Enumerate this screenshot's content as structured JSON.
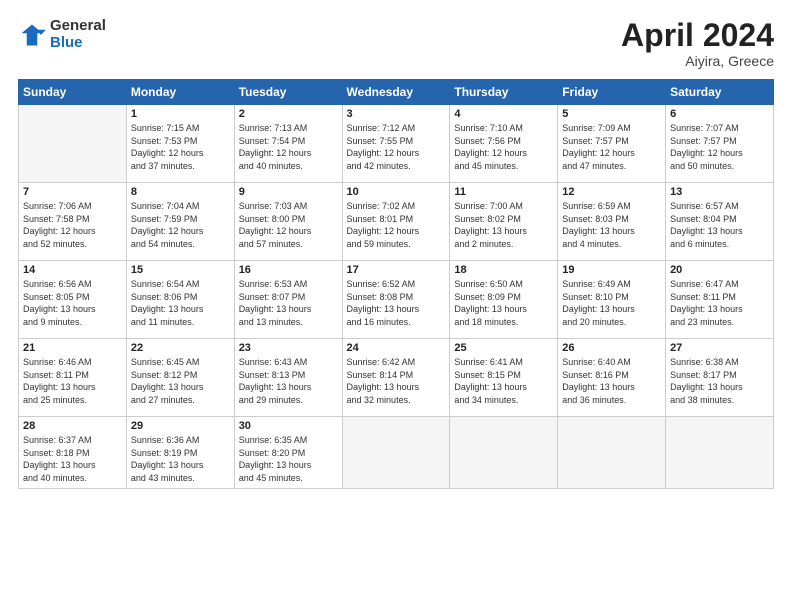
{
  "header": {
    "logo_general": "General",
    "logo_blue": "Blue",
    "month_title": "April 2024",
    "location": "Aiyira, Greece"
  },
  "days_of_week": [
    "Sunday",
    "Monday",
    "Tuesday",
    "Wednesday",
    "Thursday",
    "Friday",
    "Saturday"
  ],
  "weeks": [
    [
      {
        "num": "",
        "info": ""
      },
      {
        "num": "1",
        "info": "Sunrise: 7:15 AM\nSunset: 7:53 PM\nDaylight: 12 hours\nand 37 minutes."
      },
      {
        "num": "2",
        "info": "Sunrise: 7:13 AM\nSunset: 7:54 PM\nDaylight: 12 hours\nand 40 minutes."
      },
      {
        "num": "3",
        "info": "Sunrise: 7:12 AM\nSunset: 7:55 PM\nDaylight: 12 hours\nand 42 minutes."
      },
      {
        "num": "4",
        "info": "Sunrise: 7:10 AM\nSunset: 7:56 PM\nDaylight: 12 hours\nand 45 minutes."
      },
      {
        "num": "5",
        "info": "Sunrise: 7:09 AM\nSunset: 7:57 PM\nDaylight: 12 hours\nand 47 minutes."
      },
      {
        "num": "6",
        "info": "Sunrise: 7:07 AM\nSunset: 7:57 PM\nDaylight: 12 hours\nand 50 minutes."
      }
    ],
    [
      {
        "num": "7",
        "info": "Sunrise: 7:06 AM\nSunset: 7:58 PM\nDaylight: 12 hours\nand 52 minutes."
      },
      {
        "num": "8",
        "info": "Sunrise: 7:04 AM\nSunset: 7:59 PM\nDaylight: 12 hours\nand 54 minutes."
      },
      {
        "num": "9",
        "info": "Sunrise: 7:03 AM\nSunset: 8:00 PM\nDaylight: 12 hours\nand 57 minutes."
      },
      {
        "num": "10",
        "info": "Sunrise: 7:02 AM\nSunset: 8:01 PM\nDaylight: 12 hours\nand 59 minutes."
      },
      {
        "num": "11",
        "info": "Sunrise: 7:00 AM\nSunset: 8:02 PM\nDaylight: 13 hours\nand 2 minutes."
      },
      {
        "num": "12",
        "info": "Sunrise: 6:59 AM\nSunset: 8:03 PM\nDaylight: 13 hours\nand 4 minutes."
      },
      {
        "num": "13",
        "info": "Sunrise: 6:57 AM\nSunset: 8:04 PM\nDaylight: 13 hours\nand 6 minutes."
      }
    ],
    [
      {
        "num": "14",
        "info": "Sunrise: 6:56 AM\nSunset: 8:05 PM\nDaylight: 13 hours\nand 9 minutes."
      },
      {
        "num": "15",
        "info": "Sunrise: 6:54 AM\nSunset: 8:06 PM\nDaylight: 13 hours\nand 11 minutes."
      },
      {
        "num": "16",
        "info": "Sunrise: 6:53 AM\nSunset: 8:07 PM\nDaylight: 13 hours\nand 13 minutes."
      },
      {
        "num": "17",
        "info": "Sunrise: 6:52 AM\nSunset: 8:08 PM\nDaylight: 13 hours\nand 16 minutes."
      },
      {
        "num": "18",
        "info": "Sunrise: 6:50 AM\nSunset: 8:09 PM\nDaylight: 13 hours\nand 18 minutes."
      },
      {
        "num": "19",
        "info": "Sunrise: 6:49 AM\nSunset: 8:10 PM\nDaylight: 13 hours\nand 20 minutes."
      },
      {
        "num": "20",
        "info": "Sunrise: 6:47 AM\nSunset: 8:11 PM\nDaylight: 13 hours\nand 23 minutes."
      }
    ],
    [
      {
        "num": "21",
        "info": "Sunrise: 6:46 AM\nSunset: 8:11 PM\nDaylight: 13 hours\nand 25 minutes."
      },
      {
        "num": "22",
        "info": "Sunrise: 6:45 AM\nSunset: 8:12 PM\nDaylight: 13 hours\nand 27 minutes."
      },
      {
        "num": "23",
        "info": "Sunrise: 6:43 AM\nSunset: 8:13 PM\nDaylight: 13 hours\nand 29 minutes."
      },
      {
        "num": "24",
        "info": "Sunrise: 6:42 AM\nSunset: 8:14 PM\nDaylight: 13 hours\nand 32 minutes."
      },
      {
        "num": "25",
        "info": "Sunrise: 6:41 AM\nSunset: 8:15 PM\nDaylight: 13 hours\nand 34 minutes."
      },
      {
        "num": "26",
        "info": "Sunrise: 6:40 AM\nSunset: 8:16 PM\nDaylight: 13 hours\nand 36 minutes."
      },
      {
        "num": "27",
        "info": "Sunrise: 6:38 AM\nSunset: 8:17 PM\nDaylight: 13 hours\nand 38 minutes."
      }
    ],
    [
      {
        "num": "28",
        "info": "Sunrise: 6:37 AM\nSunset: 8:18 PM\nDaylight: 13 hours\nand 40 minutes."
      },
      {
        "num": "29",
        "info": "Sunrise: 6:36 AM\nSunset: 8:19 PM\nDaylight: 13 hours\nand 43 minutes."
      },
      {
        "num": "30",
        "info": "Sunrise: 6:35 AM\nSunset: 8:20 PM\nDaylight: 13 hours\nand 45 minutes."
      },
      {
        "num": "",
        "info": ""
      },
      {
        "num": "",
        "info": ""
      },
      {
        "num": "",
        "info": ""
      },
      {
        "num": "",
        "info": ""
      }
    ]
  ]
}
